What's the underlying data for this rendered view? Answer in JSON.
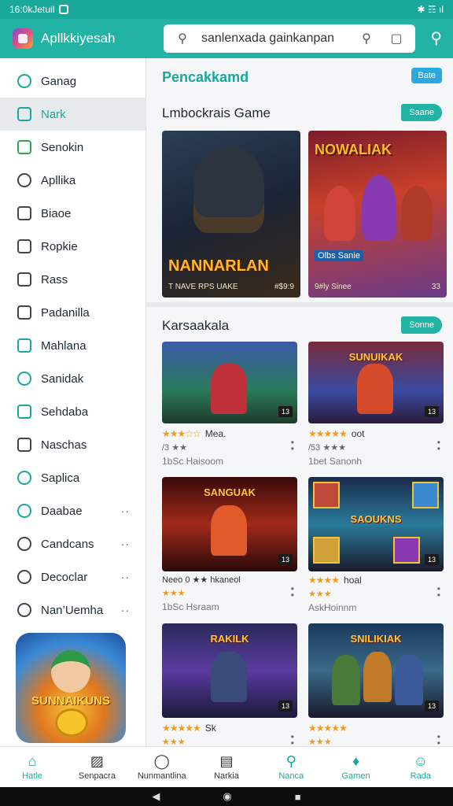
{
  "status": {
    "left_text": "16:0kJetuil",
    "right_text": "✱ ☶ ıl"
  },
  "app": {
    "title": "Apllkkiyesah"
  },
  "search": {
    "placeholder": "sanlenxada gainkanpan"
  },
  "sidebar": {
    "items": [
      {
        "label": "Ganag",
        "icon": "search-icon"
      },
      {
        "label": "Nark",
        "icon": "grid-icon",
        "active": true
      },
      {
        "label": "Senokin",
        "icon": "monitor-icon"
      },
      {
        "label": "Apllika",
        "icon": "gear-icon"
      },
      {
        "label": "Biaoe",
        "icon": "crop-icon"
      },
      {
        "label": "Ropkie",
        "icon": "doc-icon"
      },
      {
        "label": "Rass",
        "icon": "edit-icon"
      },
      {
        "label": "Padanilla",
        "icon": "frame-icon"
      },
      {
        "label": "Mahlana",
        "icon": "pen-icon"
      },
      {
        "label": "Sanidak",
        "icon": "chat-icon"
      },
      {
        "label": "Sehdaba",
        "icon": "image-icon"
      },
      {
        "label": "Naschas",
        "icon": "card-icon"
      },
      {
        "label": "Saplica",
        "icon": "check-circle-icon"
      },
      {
        "label": "Daabae",
        "icon": "cloud-icon",
        "more": "··"
      },
      {
        "label": "Candcans",
        "icon": "chat-bubble-icon",
        "more": "··"
      },
      {
        "label": "Decoclar",
        "icon": "clock-icon",
        "more": "··"
      },
      {
        "label": "Nan’Uemha",
        "icon": "history-icon",
        "more": "··"
      }
    ],
    "promo_title": "SUNNAIKUNS"
  },
  "main": {
    "section_title": "Pencakkamd",
    "section_pill": "Bate",
    "featured": {
      "title": "Lmbockrais Game",
      "pill": "Saane",
      "cards": [
        {
          "title": "NANNARLAN",
          "subtitle": "T NAVE RPS UAKE",
          "meta_right": "#$9:9"
        },
        {
          "title": "NOWALIAK",
          "subtitle": "Olbs Sanie",
          "meta_left": "9#ly Sinee",
          "meta_right": "33"
        }
      ]
    },
    "list": {
      "title": "Karsaakala",
      "pill": "Sonne",
      "items": [
        {
          "title": "",
          "badge": "13",
          "rating_text": "Mea.",
          "line2": "/3 ★★",
          "line3": "1bSc Haisoom"
        },
        {
          "title": "SUNUIKAK",
          "badge": "13",
          "rating_text": "oot",
          "line2": "/53 ★★★",
          "line3": "1bet Sanonh"
        },
        {
          "title": "SANGUAK",
          "badge": "13",
          "rating_text": "Neeo 0 ★★ hkaneol",
          "line2": "★★★",
          "line3": "1bSc Hsraam"
        },
        {
          "title": "SAOUKNS",
          "badge": "13",
          "rating_text": "hoal",
          "line2": "★★★",
          "line3": "AskHoinnm"
        },
        {
          "title": "RAKILK",
          "badge": "13",
          "rating_text": "Sk",
          "line2": "★★★",
          "line3": ""
        },
        {
          "title": "SNILIKIAK",
          "badge": "13",
          "rating_text": "",
          "line2": "★★★",
          "line3": ""
        }
      ]
    }
  },
  "bottomnav": [
    {
      "label": "Hatle",
      "icon": "home-icon",
      "active": true
    },
    {
      "label": "Senpacra",
      "icon": "book-icon"
    },
    {
      "label": "Nunmantlina",
      "icon": "compass-icon"
    },
    {
      "label": "Narkia",
      "icon": "list-icon"
    },
    {
      "label": "Nanca",
      "icon": "search-icon",
      "teal": true
    },
    {
      "label": "Gamen",
      "icon": "gamepad-icon",
      "teal": true
    },
    {
      "label": "Rada",
      "icon": "person-icon",
      "teal": true
    }
  ],
  "colors": {
    "accent": "#22b3a4",
    "pill_blue": "#2aa8e0",
    "star": "#f29a1f"
  }
}
